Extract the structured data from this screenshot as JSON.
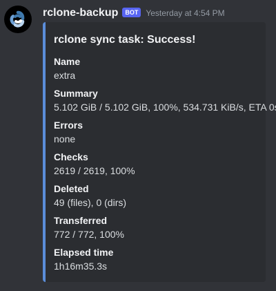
{
  "message": {
    "username": "rclone-backup",
    "bot_tag": "BOT",
    "timestamp": "Yesterday at 4:54 PM",
    "avatar_icon": "rclone-logo-icon"
  },
  "embed": {
    "accent_color": "#5b8dd9",
    "title": "rclone sync task: Success!",
    "fields": [
      {
        "name": "Name",
        "value": "extra"
      },
      {
        "name": "Summary",
        "value": "5.102 GiB / 5.102 GiB, 100%, 534.731 KiB/s, ETA 0s"
      },
      {
        "name": "Errors",
        "value": "none"
      },
      {
        "name": "Checks",
        "value": "2619 / 2619, 100%"
      },
      {
        "name": "Deleted",
        "value": "49 (files), 0 (dirs)"
      },
      {
        "name": "Transferred",
        "value": "772 / 772, 100%"
      },
      {
        "name": "Elapsed time",
        "value": "1h16m35.3s"
      }
    ]
  },
  "colors": {
    "background": "#313338",
    "embed_background": "#2b2d31",
    "bot_tag": "#5865f2",
    "timestamp": "#949ba4"
  }
}
